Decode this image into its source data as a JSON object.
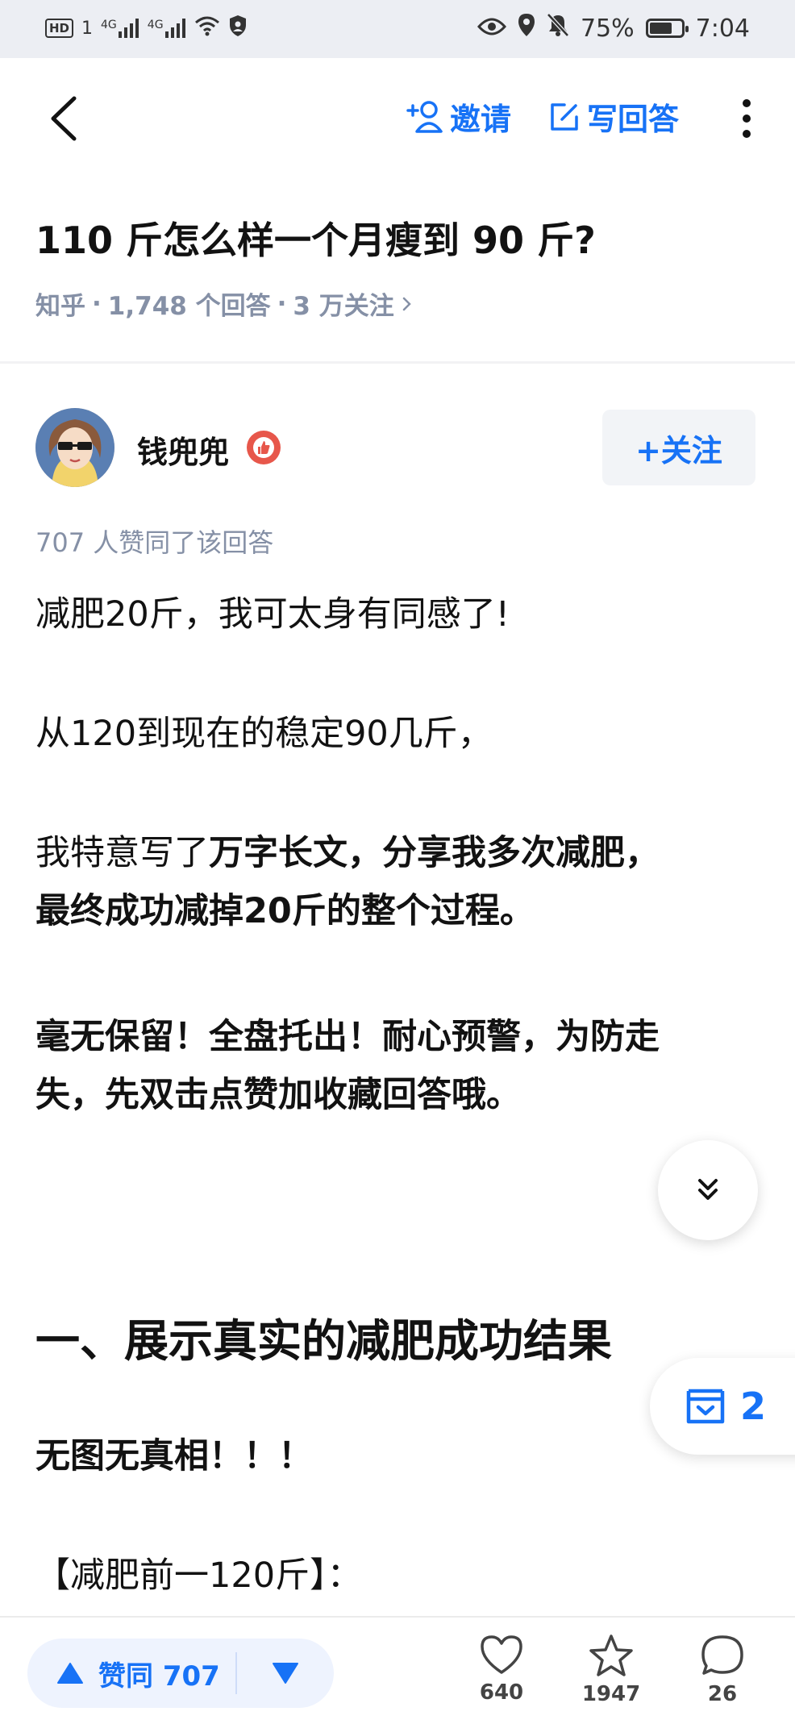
{
  "status_bar": {
    "hd_label": "HD",
    "sim": "1",
    "network1": "4G",
    "network2": "4G",
    "battery": "75%",
    "battery_level": 0.75,
    "time": "7:04"
  },
  "nav": {
    "invite_label": "邀请",
    "write_answer_label": "写回答"
  },
  "question": {
    "title": "110 斤怎么样一个月瘦到 90 斤?",
    "source": "知乎",
    "answers": "1,748 个回答",
    "followers": "3 万关注"
  },
  "author": {
    "name": "钱兜兜",
    "follow_label": "+关注"
  },
  "answer": {
    "vote_summary": "707 人赞同了该回答",
    "p1": "减肥20斤，我可太身有同感了!",
    "p2": "从120到现在的稳定90几斤，",
    "p3_pre": "我特意写了",
    "p3_bold": "万字长文，分享我多次减肥，",
    "p3_line2": "最终成功减掉20斤的整个过程。",
    "p4_line1": "毫无保留！全盘托出！耐心预警，为防走",
    "p4_line2": "失，先双击点赞加收藏回答哦。",
    "heading1": "一、展示真实的减肥成功结果",
    "p5": "无图无真相！！！",
    "p6": "【减肥前一120斤】："
  },
  "floating": {
    "collection_count": "2"
  },
  "bottom_bar": {
    "upvote_label": "赞同 707",
    "like_count": "640",
    "favorite_count": "1947",
    "comment_count": "26"
  },
  "colors": {
    "accent": "#1772f6",
    "muted": "#8590a6",
    "text": "#121212",
    "status_bg": "#eceef3"
  }
}
